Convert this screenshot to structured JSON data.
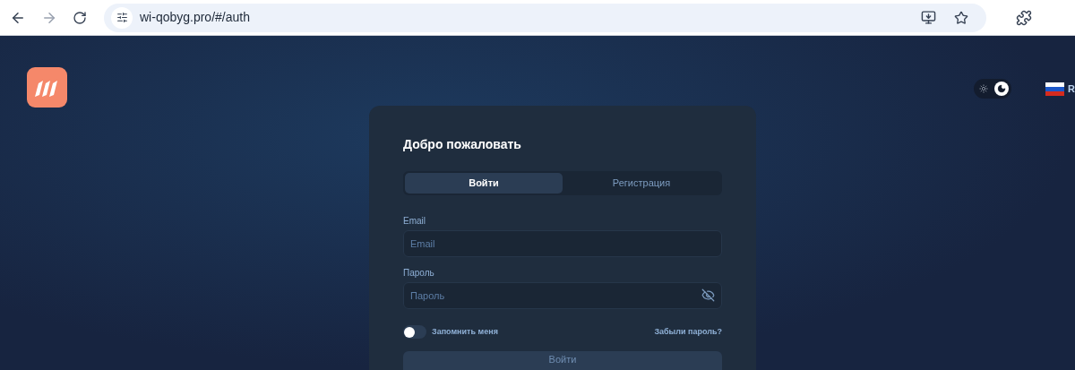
{
  "browser": {
    "url": "wi-qobyg.pro/#/auth"
  },
  "header": {
    "theme_dark": true,
    "language": "R"
  },
  "card": {
    "title": "Добро пожаловать",
    "tabs": [
      {
        "label": "Войти",
        "selected": true
      },
      {
        "label": "Регистрация",
        "selected": false
      }
    ],
    "fields": [
      {
        "label": "Email",
        "placeholder": "Email",
        "kind": "text"
      },
      {
        "label": "Пароль",
        "placeholder": "Пароль",
        "kind": "password"
      }
    ],
    "remember": {
      "label": "Запомнить меня",
      "on": false
    },
    "forgot": "Забыли пароль?",
    "submit": "Войти"
  }
}
